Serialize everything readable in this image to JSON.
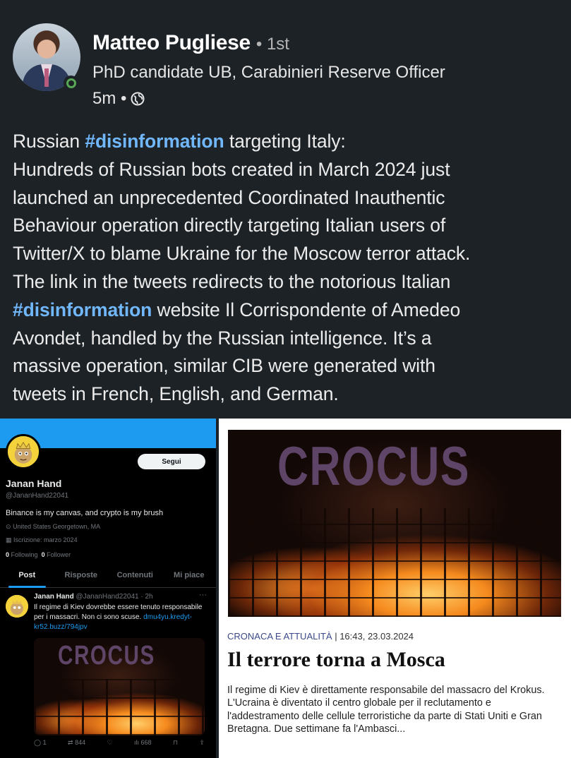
{
  "post": {
    "author_name": "Matteo Pugliese",
    "degree": "• 1st",
    "headline": "PhD candidate UB, Carabinieri Reserve Officer",
    "time": "5m •",
    "visibility_icon": "globe-icon",
    "text_lines": [
      [
        {
          "t": "Russian "
        },
        {
          "t": "#disinformation",
          "tag": true
        },
        {
          "t": " targeting Italy:"
        }
      ],
      [
        {
          "t": "Hundreds of Russian bots created in March 2024 just"
        }
      ],
      [
        {
          "t": "launched an unprecedented Coordinated Inauthentic"
        }
      ],
      [
        {
          "t": "Behaviour operation directly targeting Italian users of"
        }
      ],
      [
        {
          "t": "Twitter/X to blame Ukraine for the Moscow terror attack."
        }
      ],
      [
        {
          "t": "The link in the tweets redirects to the notorious Italian"
        }
      ],
      [
        {
          "t": "#disinformation",
          "tag": true
        },
        {
          "t": " website Il Corrispondente of Amedeo"
        }
      ],
      [
        {
          "t": "Avondet, handled by the Russian intelligence. It’s a"
        }
      ],
      [
        {
          "t": "massive operation, similar CIB were generated with"
        }
      ],
      [
        {
          "t": "tweets in French, English, and German."
        }
      ]
    ]
  },
  "twitter": {
    "follow_label": "Segui",
    "name": "Janan Hand",
    "handle": "@JananHand22041",
    "bio": "Binance is my canvas, and crypto is my brush",
    "location": "United States  Georgetown, MA",
    "joined": "Iscrizione: marzo 2024",
    "following_count": "0",
    "following_label": "Following",
    "followers_count": "0",
    "followers_label": "Follower",
    "tabs": [
      "Post",
      "Risposte",
      "Contenuti",
      "Mi piace"
    ],
    "tweet": {
      "name": "Janan Hand",
      "handle_time": "@JananHand22041 · 2h",
      "more": "···",
      "text": "Il regime di Kiev dovrebbe essere tenuto responsabile per i massacri. Non ci sono scuse. ",
      "link": "dmu4yu.kredyt-kr52.buzz/794jpv",
      "media_text": "CROCUS",
      "replies": "1",
      "retweets": "844",
      "views": "668"
    }
  },
  "article": {
    "photo_text": "CROCUS",
    "category": "CRONACA E ATTUALITÀ",
    "separator": " | ",
    "datetime": "16:43, 23.03.2024",
    "title": "Il terrore torna a Mosca",
    "body": "Il regime di Kiev è direttamente responsabile del massacro del Krokus. L'Ucraina è diventato il centro globale per il reclutamento e l'addestramento delle cellule terroristiche da parte di Stati Uniti e Gran Bretagna. Due settimane fa l'Ambasci..."
  },
  "colors": {
    "background": "#1d2226",
    "hashtag": "#71b7fb",
    "online_ring": "#57a755",
    "twitter_blue": "#1d9bf0",
    "article_category": "#3b4a8a"
  }
}
